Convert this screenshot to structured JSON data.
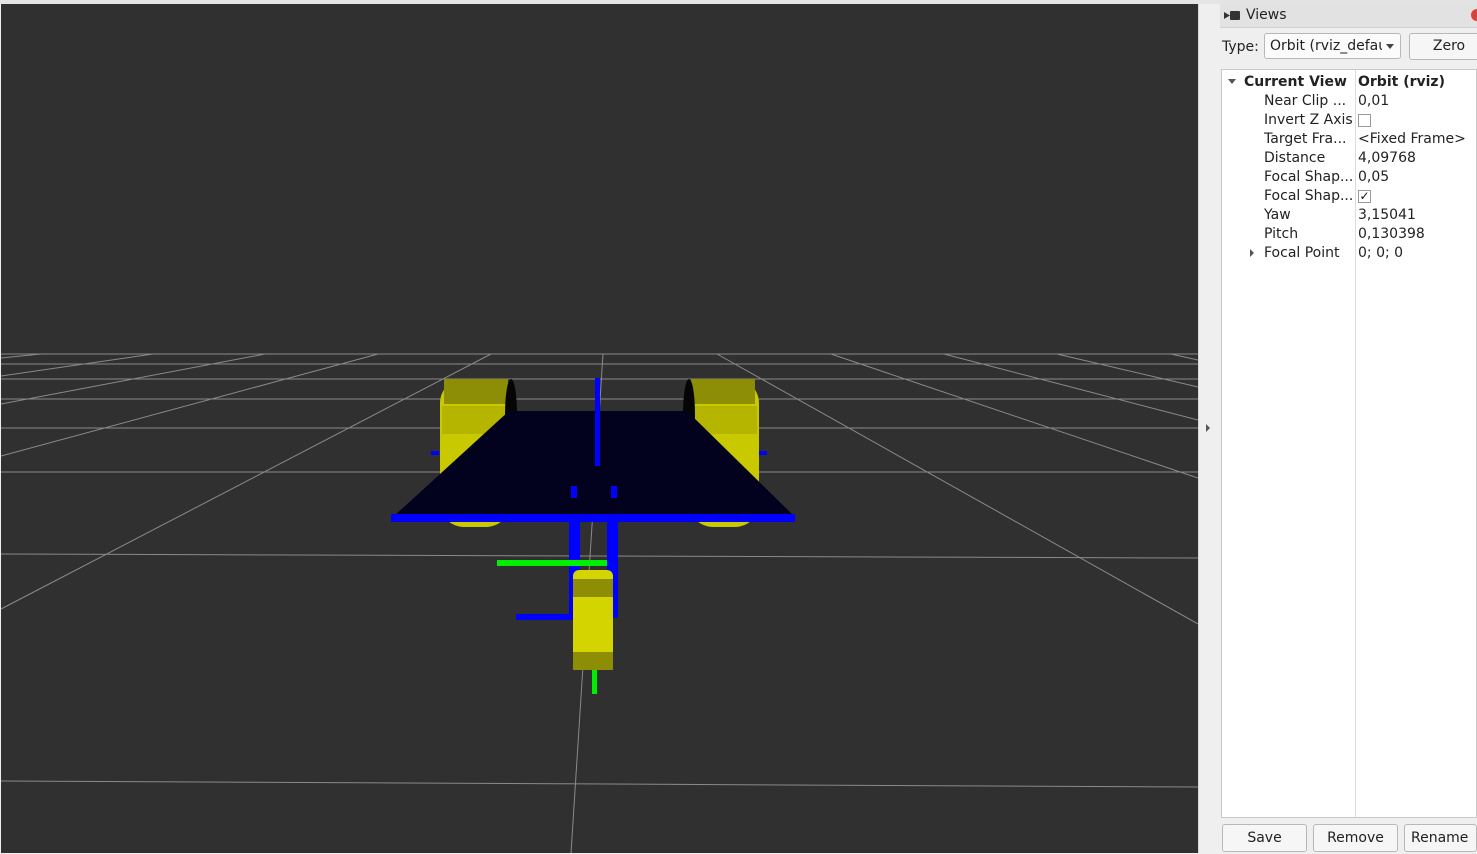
{
  "panel": {
    "title": "Views",
    "type_label": "Type:",
    "type_value": "Orbit (rviz_defau",
    "zero_label": "Zero"
  },
  "current_view": {
    "label": "Current View",
    "value": "Orbit (rviz)",
    "properties": [
      {
        "name": "Near Clip ...",
        "value": "0,01"
      },
      {
        "name": "Invert Z Axis",
        "checked": false
      },
      {
        "name": "Target Fra...",
        "value": "<Fixed Frame>"
      },
      {
        "name": "Distance",
        "value": "4,09768"
      },
      {
        "name": "Focal Shap...",
        "value": "0,05"
      },
      {
        "name": "Focal Shap...",
        "checked": true
      },
      {
        "name": "Yaw",
        "value": "3,15041"
      },
      {
        "name": "Pitch",
        "value": "0,130398"
      },
      {
        "name": "Focal Point",
        "value": "0; 0; 0"
      }
    ]
  },
  "buttons": {
    "save": "Save",
    "remove": "Remove",
    "rename": "Rename"
  },
  "scene": {
    "background_color": "#303030",
    "grid_color": "#a0a0a0",
    "chassis_color": "#02021f",
    "frame_color": "#0000ff",
    "wheel_color": "#d4d400",
    "axis_green": "#00ee00"
  }
}
